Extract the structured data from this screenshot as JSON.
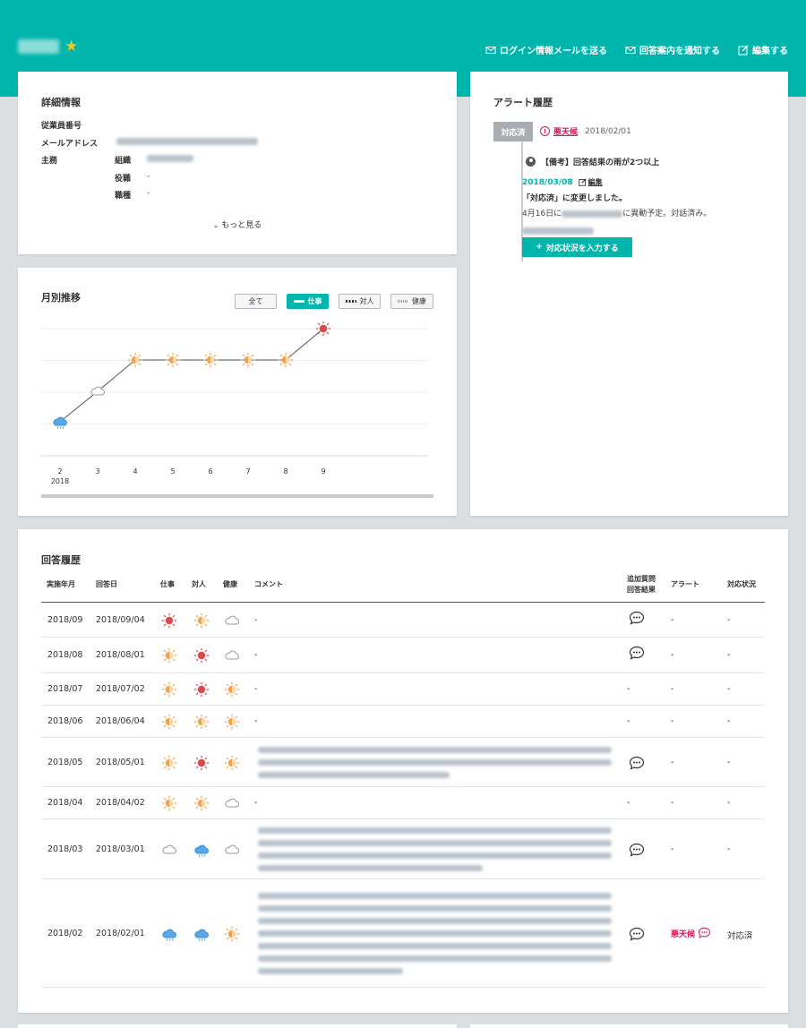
{
  "header": {
    "actions": [
      {
        "label": "ログイン情報メールを送る",
        "icon": "mail-icon"
      },
      {
        "label": "回答案内を通知する",
        "icon": "mail-icon"
      },
      {
        "label": "編集する",
        "icon": "edit-icon"
      }
    ]
  },
  "detail": {
    "title": "詳細情報",
    "employee_no_label": "従業員番号",
    "email_label": "メールアドレス",
    "main_label": "主務",
    "org_label": "組織",
    "position_label": "役職",
    "position_value": "-",
    "job_label": "職種",
    "job_value": "-",
    "more": "もっと見る"
  },
  "alerts": {
    "title": "アラート履歴",
    "status_badge": "対応済",
    "type": "悪天候",
    "date": "2018/02/01",
    "note": "【備考】回答結果の雨が2つ以上",
    "entry_date": "2018/03/08",
    "edit": "編集",
    "message": "「対応済」に変更しました。",
    "detail_prefix": "4月16日に",
    "detail_suffix": "に異動予定。対話済み。",
    "add_button": "対応状況を入力する"
  },
  "monthly": {
    "title": "月別推移",
    "filters": [
      {
        "label": "全て",
        "active": false,
        "style": "none"
      },
      {
        "label": "仕事",
        "active": true,
        "style": "solid"
      },
      {
        "label": "対人",
        "active": false,
        "style": "dashed"
      },
      {
        "label": "健康",
        "active": false,
        "style": "dotted"
      }
    ]
  },
  "chart_data": {
    "type": "line",
    "categories": [
      "2",
      "3",
      "4",
      "5",
      "6",
      "7",
      "8",
      "9"
    ],
    "year_label": "2018",
    "series": [
      {
        "values": [
          "rain",
          "cloudy",
          "sun-cloud",
          "sun-cloud",
          "sun-cloud",
          "sun-cloud",
          "sun-cloud",
          "sunny"
        ]
      }
    ],
    "levels": {
      "rain": 1,
      "cloudy": 2,
      "sun-cloud": 3,
      "sunny": 4
    },
    "ylim": [
      0,
      4
    ],
    "grid": true
  },
  "history": {
    "title": "回答履歴",
    "columns": [
      "実施年月",
      "回答日",
      "仕事",
      "対人",
      "健康",
      "コメント",
      "追加質問",
      "回答結果",
      "アラート",
      "対応状況"
    ],
    "rows": [
      {
        "month": "2018/09",
        "date": "2018/09/04",
        "work": "sunny",
        "people": "sun-cloud",
        "health": "cloudy",
        "comment": "-",
        "extra": true,
        "alert": "-",
        "status": "-",
        "blur_lines": 0
      },
      {
        "month": "2018/08",
        "date": "2018/08/01",
        "work": "sun-cloud",
        "people": "sunny",
        "health": "cloudy",
        "comment": "-",
        "extra": true,
        "alert": "-",
        "status": "-",
        "blur_lines": 0
      },
      {
        "month": "2018/07",
        "date": "2018/07/02",
        "work": "sun-cloud",
        "people": "sunny",
        "health": "sun-cloud",
        "comment": "-",
        "extra": false,
        "extra_text": "-",
        "alert": "-",
        "status": "-",
        "blur_lines": 0
      },
      {
        "month": "2018/06",
        "date": "2018/06/04",
        "work": "sun-cloud",
        "people": "sun-cloud",
        "health": "sun-cloud",
        "comment": "-",
        "extra": false,
        "extra_text": "-",
        "alert": "-",
        "status": "-",
        "blur_lines": 0
      },
      {
        "month": "2018/05",
        "date": "2018/05/01",
        "work": "sun-cloud",
        "people": "sunny",
        "health": "sun-cloud",
        "comment": "",
        "extra": true,
        "alert": "-",
        "status": "-",
        "blur_lines": 3
      },
      {
        "month": "2018/04",
        "date": "2018/04/02",
        "work": "sun-cloud",
        "people": "sun-cloud",
        "health": "cloudy",
        "comment": "-",
        "extra": false,
        "extra_text": "-",
        "alert": "-",
        "status": "-",
        "blur_lines": 0
      },
      {
        "month": "2018/03",
        "date": "2018/03/01",
        "work": "cloudy",
        "people": "rain",
        "health": "cloudy",
        "comment": "",
        "extra": true,
        "alert": "-",
        "status": "-",
        "blur_lines": 4
      },
      {
        "month": "2018/02",
        "date": "2018/02/01",
        "work": "rain",
        "people": "rain",
        "health": "sun-cloud",
        "comment": "",
        "extra": true,
        "alert": "悪天候",
        "status": "対応済",
        "blur_lines": 7
      }
    ]
  }
}
